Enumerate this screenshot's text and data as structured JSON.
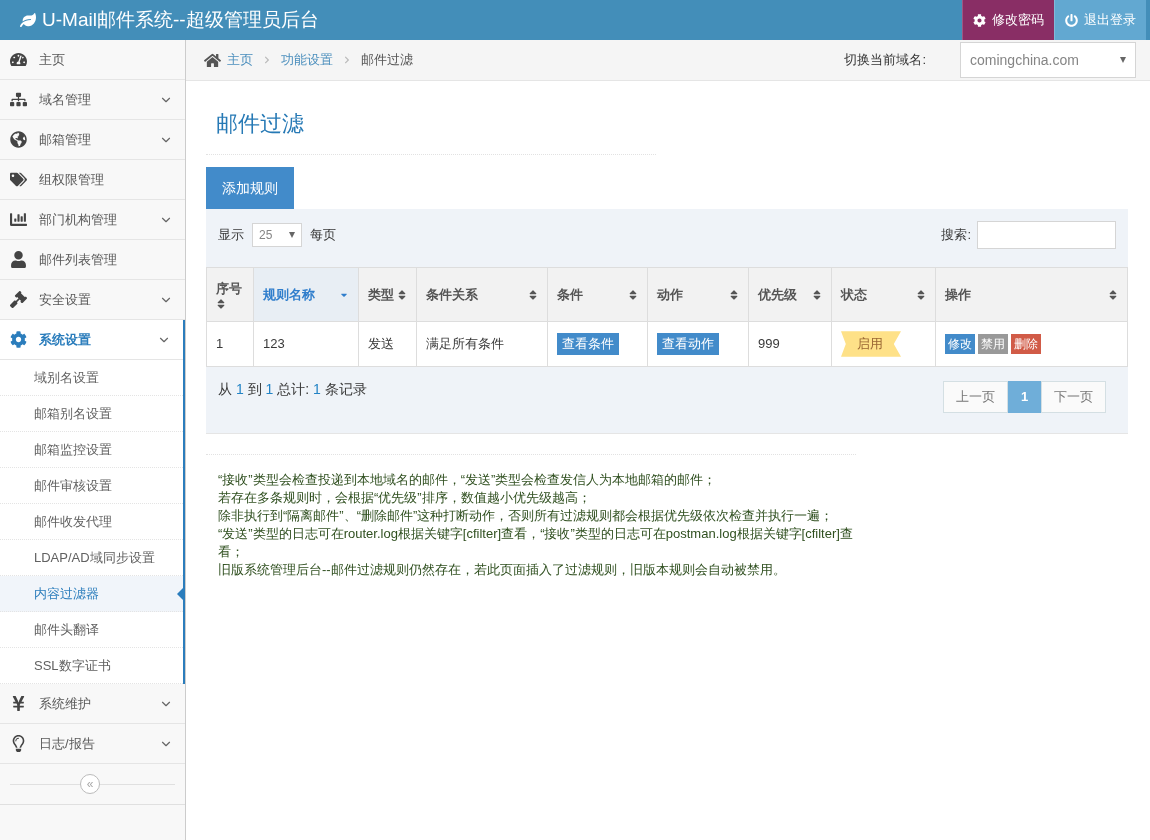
{
  "header": {
    "title": "U-Mail邮件系统--超级管理员后台",
    "buttons": [
      {
        "kind": "password",
        "label": "修改密码"
      },
      {
        "kind": "logout",
        "label": "退出登录"
      }
    ]
  },
  "sidebar": {
    "items": [
      {
        "label": "主页",
        "expandable": false,
        "selected": false
      },
      {
        "label": "域名管理",
        "expandable": true,
        "selected": false
      },
      {
        "label": "邮箱管理",
        "expandable": true,
        "selected": false
      },
      {
        "label": "组权限管理",
        "expandable": false,
        "selected": false
      },
      {
        "label": "部门机构管理",
        "expandable": true,
        "selected": false
      },
      {
        "label": "邮件列表管理",
        "expandable": false,
        "selected": false
      },
      {
        "label": "安全设置",
        "expandable": true,
        "selected": false
      },
      {
        "label": "系统设置",
        "expandable": true,
        "selected": true,
        "children": [
          {
            "label": "域别名设置",
            "selected": false
          },
          {
            "label": "邮箱别名设置",
            "selected": false
          },
          {
            "label": "邮箱监控设置",
            "selected": false
          },
          {
            "label": "邮件审核设置",
            "selected": false
          },
          {
            "label": "邮件收发代理",
            "selected": false
          },
          {
            "label": "LDAP/AD域同步设置",
            "selected": false
          },
          {
            "label": "内容过滤器",
            "selected": true
          },
          {
            "label": "邮件头翻译",
            "selected": false
          },
          {
            "label": "SSL数字证书",
            "selected": false
          }
        ]
      },
      {
        "label": "系统维护",
        "expandable": true,
        "selected": false
      },
      {
        "label": "日志/报告",
        "expandable": true,
        "selected": false
      }
    ],
    "collapse_label": "«"
  },
  "breadcrumb": [
    "主页",
    "功能设置",
    "邮件过滤"
  ],
  "domain_switch": {
    "label": "切换当前域名:",
    "value": "comingchina.com"
  },
  "page_title": "邮件过滤",
  "add_button": "添加规则",
  "table_controls": {
    "show_label": "显示",
    "page_size": "25",
    "per_page": "每页",
    "search_label": "搜索:"
  },
  "table": {
    "columns": [
      {
        "label": "序号",
        "sorted": false
      },
      {
        "label": "规则名称",
        "sorted": true
      },
      {
        "label": "类型",
        "sorted": false
      },
      {
        "label": "条件关系",
        "sorted": false
      },
      {
        "label": "条件",
        "sorted": false
      },
      {
        "label": "动作",
        "sorted": false
      },
      {
        "label": "优先级",
        "sorted": false
      },
      {
        "label": "状态",
        "sorted": false
      },
      {
        "label": "操作",
        "sorted": false
      }
    ],
    "rows": [
      {
        "index": "1",
        "name": "123",
        "type": "发送",
        "relation": "满足所有条件",
        "condition_button": "查看条件",
        "action_button": "查看动作",
        "priority": "999",
        "status": "启用",
        "actions": [
          {
            "label": "修改",
            "color": "#428bca"
          },
          {
            "label": "禁用",
            "color": "#999999"
          },
          {
            "label": "删除",
            "color": "#d15b47"
          }
        ]
      }
    ]
  },
  "summary": [
    {
      "kind": "text",
      "text": "从"
    },
    {
      "kind": "number",
      "text": "1"
    },
    {
      "kind": "text",
      "text": "到"
    },
    {
      "kind": "number",
      "text": "1"
    },
    {
      "kind": "text",
      "text": "总计:"
    },
    {
      "kind": "number",
      "text": "1"
    },
    {
      "kind": "text",
      "text": "条记录"
    }
  ],
  "pagination": {
    "prev": "上一页",
    "pages": [
      {
        "label": "1",
        "selected": true
      }
    ],
    "next": "下一页"
  },
  "notes": [
    "“接收”类型会检查投递到本地域名的邮件，“发送”类型会检查发信人为本地邮箱的邮件；",
    "若存在多条规则时，会根据“优先级”排序，数值越小优先级越高；",
    "除非执行到“隔离邮件”、“删除邮件”这种打断动作，否则所有过滤规则都会根据优先级依次检查并执行一遍；",
    "“发送”类型的日志可在router.log根据关键字[cfilter]查看，“接收”类型的日志可在postman.log根据关键字[cfilter]查看；",
    "旧版系统管理后台--邮件过滤规则仍然存在，若此页面插入了过滤规则，旧版本规则会自动被禁用。"
  ]
}
